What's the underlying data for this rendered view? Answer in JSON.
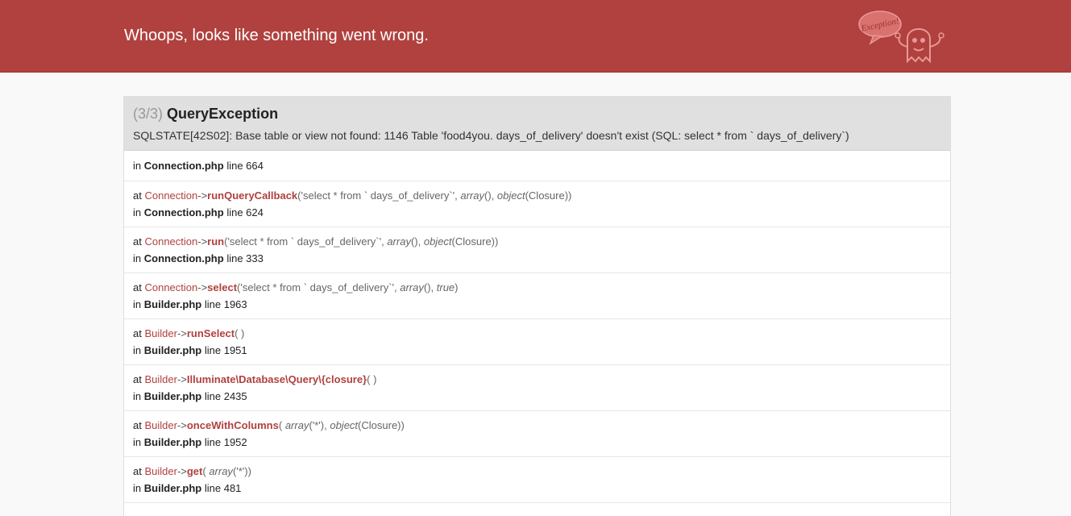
{
  "header": {
    "title": "Whoops, looks like something went wrong.",
    "mascot_text": "Exception!"
  },
  "exception": {
    "count": "(3/3)",
    "class": "QueryException",
    "message": "SQLSTATE[42S02]: Base table or view not found: 1146 Table 'food4you. days_of_delivery' doesn't exist (SQL: select * from ` days_of_delivery`)"
  },
  "trace": {
    "f0": {
      "in": "in",
      "file": "Connection.php",
      "line": "line 664"
    },
    "f1": {
      "at": "at",
      "class": "Connection",
      "arrow": "->",
      "fn": "runQueryCallback",
      "a1": "('select * from ` days_of_delivery`', ",
      "a2": "array",
      "a3": "(), ",
      "a4": "object",
      "a5": "(Closure))",
      "in": "in",
      "file": "Connection.php",
      "line": "line 624"
    },
    "f2": {
      "at": "at",
      "class": "Connection",
      "arrow": "->",
      "fn": "run",
      "a1": "('select * from ` days_of_delivery`', ",
      "a2": "array",
      "a3": "(), ",
      "a4": "object",
      "a5": "(Closure))",
      "in": "in",
      "file": "Connection.php",
      "line": "line 333"
    },
    "f3": {
      "at": "at",
      "class": "Connection",
      "arrow": "->",
      "fn": "select",
      "a1": "('select * from ` days_of_delivery`', ",
      "a2": "array",
      "a3": "(), ",
      "a4": "true",
      "a5": ")",
      "in": "in",
      "file": "Builder.php",
      "line": "line 1963"
    },
    "f4": {
      "at": "at",
      "class": "Builder",
      "arrow": "->",
      "fn": "runSelect",
      "a1": "( )",
      "in": "in",
      "file": "Builder.php",
      "line": "line 1951"
    },
    "f5": {
      "at": "at",
      "class": "Builder",
      "arrow": "->",
      "fn": "Illuminate\\Database\\Query\\{closure}",
      "a1": "( )",
      "in": "in",
      "file": "Builder.php",
      "line": "line 2435"
    },
    "f6": {
      "at": "at",
      "class": "Builder",
      "arrow": "->",
      "fn": "onceWithColumns",
      "a1": "( ",
      "a2": "array",
      "a3": "('*'), ",
      "a4": "object",
      "a5": "(Closure))",
      "in": "in",
      "file": "Builder.php",
      "line": "line 1952"
    },
    "f7": {
      "at": "at",
      "class": "Builder",
      "arrow": "->",
      "fn": "get",
      "a1": "( ",
      "a2": "array",
      "a3": "('*'))",
      "in": "in",
      "file": "Builder.php",
      "line": "line 481"
    }
  }
}
